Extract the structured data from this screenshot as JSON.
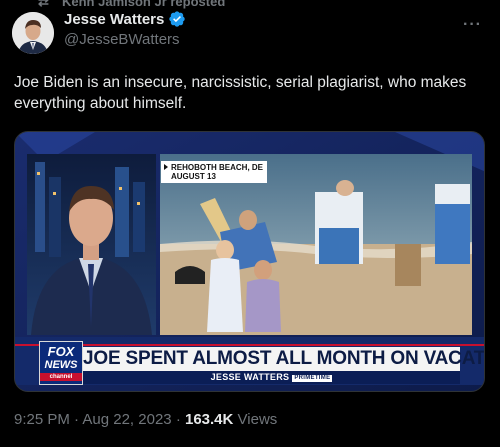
{
  "repost": {
    "text": "Kenn Jamison Jr reposted",
    "icon": "repost-icon"
  },
  "author": {
    "name": "Jesse Watters",
    "handle": "@JesseBWatters",
    "verified": true,
    "verified_color": "#1d9bf0",
    "avatar_icon": "avatar"
  },
  "more_icon": "more-options-icon",
  "tweet": {
    "text": "Joe Biden is an insecure, narcissistic, serial plagiarist, who makes everything about himself."
  },
  "media": {
    "location_tag_line1": "REHOBOTH BEACH, DE",
    "location_tag_line2": "AUGUST 13",
    "logo_line1": "FOX",
    "logo_line2": "NEWS",
    "logo_line3": "channel",
    "headline": "JOE SPENT ALMOST ALL MONTH ON VACATION",
    "show_name": "JESSE WATTERS",
    "show_suffix": "PRIMETIME"
  },
  "meta": {
    "time": "9:25 PM",
    "date": "Aug 22, 2023",
    "separator": "·",
    "views_count": "163.4K",
    "views_label": "Views"
  },
  "colors": {
    "background": "#000000",
    "text": "#e7e9ea",
    "secondary_text": "#71767b",
    "accent": "#1d9bf0",
    "fox_blue": "#0b1e56",
    "fox_red": "#c8102e"
  }
}
